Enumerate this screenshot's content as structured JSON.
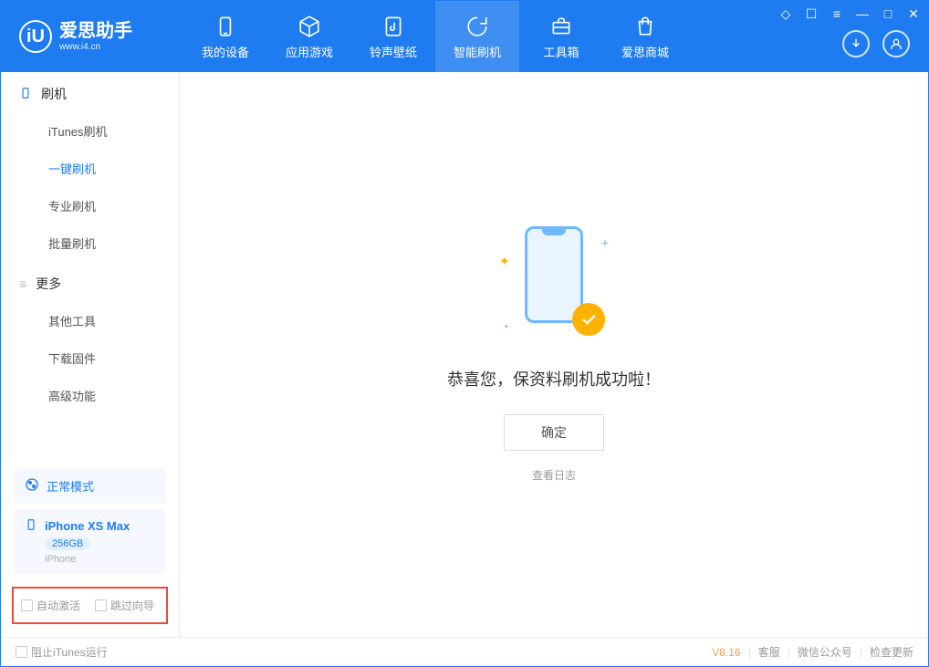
{
  "app": {
    "logo_letter": "iU",
    "title": "爱思助手",
    "subtitle": "www.i4.cn"
  },
  "nav": {
    "tabs": [
      {
        "label": "我的设备"
      },
      {
        "label": "应用游戏"
      },
      {
        "label": "铃声壁纸"
      },
      {
        "label": "智能刷机"
      },
      {
        "label": "工具箱"
      },
      {
        "label": "爱思商城"
      }
    ]
  },
  "sidebar": {
    "group1_title": "刷机",
    "items1": [
      {
        "label": "iTunes刷机"
      },
      {
        "label": "一键刷机"
      },
      {
        "label": "专业刷机"
      },
      {
        "label": "批量刷机"
      }
    ],
    "group2_title": "更多",
    "items2": [
      {
        "label": "其他工具"
      },
      {
        "label": "下载固件"
      },
      {
        "label": "高级功能"
      }
    ],
    "mode_card": "正常模式",
    "device": {
      "name": "iPhone XS Max",
      "storage": "256GB",
      "type": "iPhone"
    },
    "checkboxes": {
      "auto_activate": "自动激活",
      "skip_guide": "跳过向导"
    }
  },
  "main": {
    "success_message": "恭喜您，保资料刷机成功啦！",
    "ok_button": "确定",
    "view_log": "查看日志"
  },
  "status": {
    "block_itunes": "阻止iTunes运行",
    "version": "V8.16",
    "links": {
      "support": "客服",
      "wechat": "微信公众号",
      "update": "检查更新"
    }
  }
}
